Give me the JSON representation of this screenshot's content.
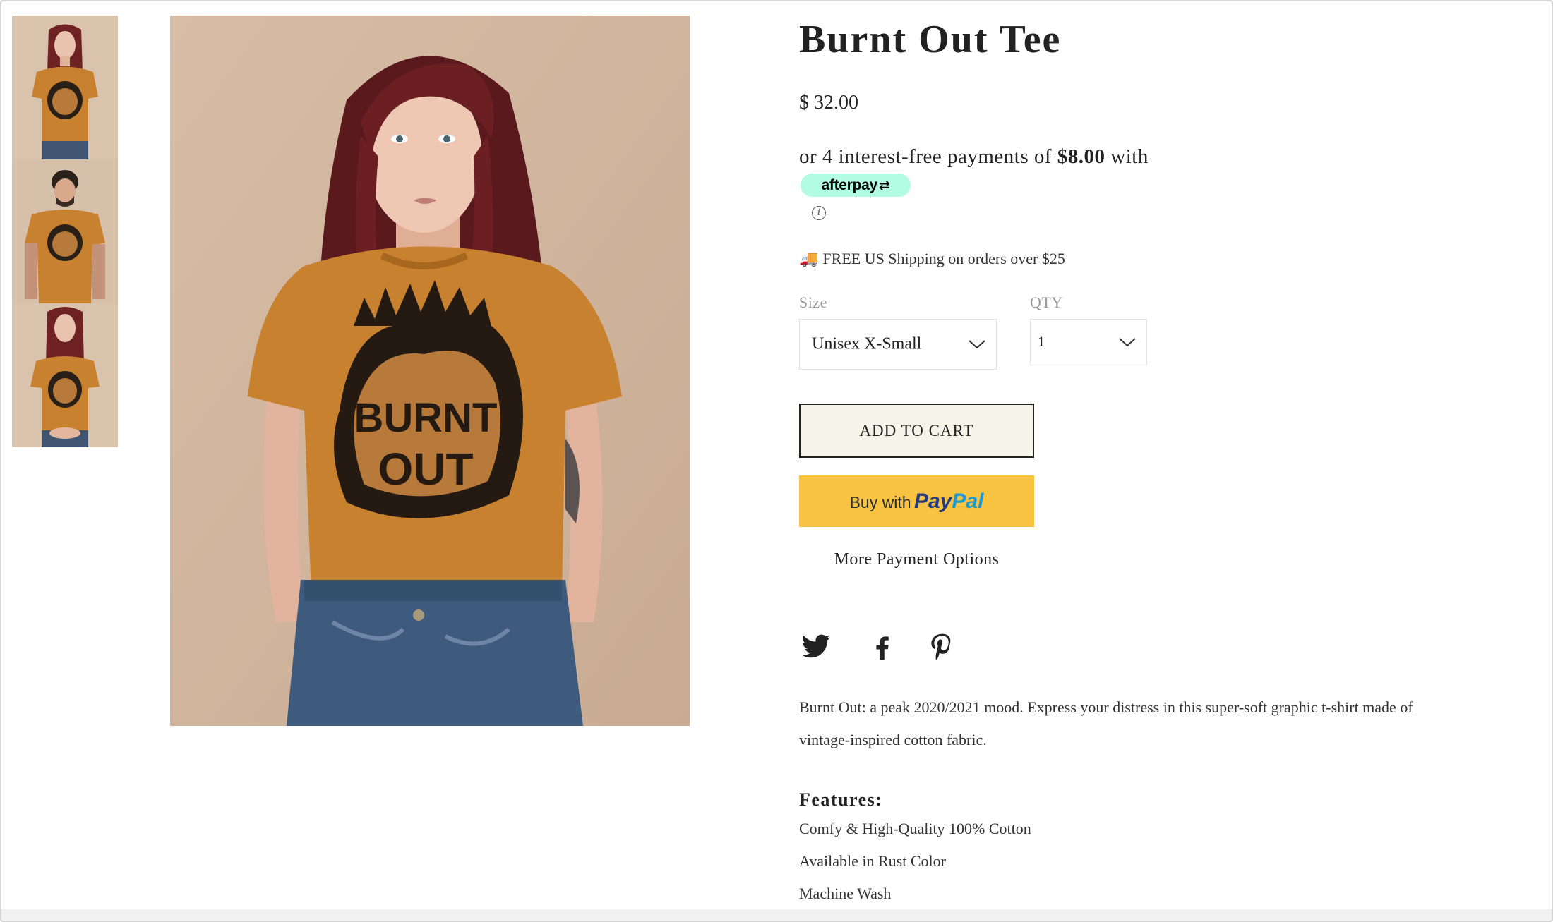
{
  "product": {
    "title": "Burnt Out Tee",
    "price": "$ 32.00",
    "shirt_print_line1": "BURNT",
    "shirt_print_line2": "OUT"
  },
  "afterpay": {
    "text_before": "or 4 interest-free payments of ",
    "amount": "$8.00",
    "text_after": " with",
    "badge": "afterpay",
    "badge_color": "#b2fce4"
  },
  "shipping": {
    "icon": "truck-icon",
    "text": "FREE US Shipping on orders over $25"
  },
  "options": {
    "size_label": "Size",
    "size_value": "Unisex X-Small",
    "qty_label": "QTY",
    "qty_value": "1"
  },
  "buttons": {
    "add_to_cart": "ADD TO CART",
    "paypal_prefix": "Buy with",
    "paypal_brand_1": "Pay",
    "paypal_brand_2": "Pal",
    "more_payment": "More Payment Options"
  },
  "social": [
    "twitter-icon",
    "facebook-icon",
    "pinterest-icon"
  ],
  "description": "Burnt Out: a peak 2020/2021 mood. Express your distress in this super-soft graphic t-shirt made of vintage-inspired cotton fabric.",
  "features": {
    "title": "Features:",
    "items": [
      "Comfy & High-Quality 100% Cotton",
      "Available in Rust Color",
      "Machine Wash"
    ]
  },
  "colors": {
    "add_to_cart_bg": "#f6f3e9",
    "paypal_bg": "#f7c341",
    "shirt": "#c7812f",
    "backdrop": "#dcc5b0"
  }
}
